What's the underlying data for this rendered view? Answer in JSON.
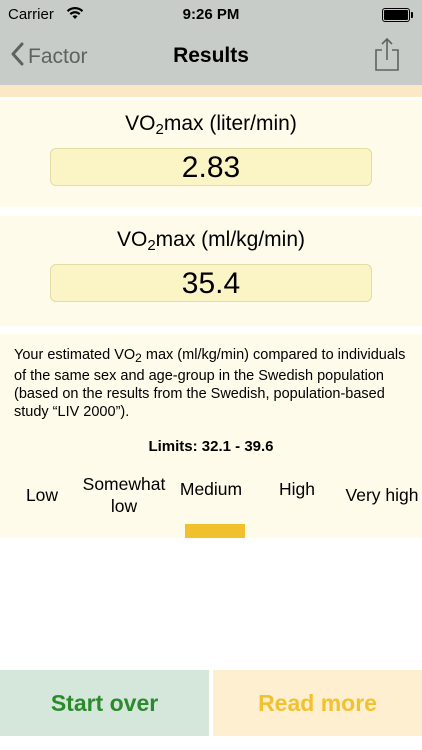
{
  "status_bar": {
    "carrier": "Carrier",
    "time": "9:26 PM",
    "battery_level": 1.0
  },
  "nav": {
    "back_label": "Factor",
    "title": "Results"
  },
  "vo2_absolute": {
    "label_prefix": "VO",
    "label_sub": "2",
    "label_suffix": "max (liter/min)",
    "value": "2.83"
  },
  "vo2_relative": {
    "label_prefix": "VO",
    "label_sub": "2",
    "label_suffix": "max (ml/kg/min)",
    "value": "35.4"
  },
  "info": {
    "desc_prefix": "Your estimated VO",
    "desc_sub": "2",
    "desc_suffix": " max (ml/kg/min) compared to individuals of the same sex and age-group in the Swedish population (based on the results from the Swedish, population-based study “LIV 2000”).",
    "limits": "Limits: 32.1 - 39.6"
  },
  "scale": {
    "categories": [
      "Low",
      "Somewhat low",
      "Medium",
      "High",
      "Very high"
    ],
    "selected_index": 2,
    "indicator_color": "#f1c02d"
  },
  "buttons": {
    "start_over": "Start over",
    "read_more": "Read more"
  },
  "colors": {
    "header_bg": "#c8ccc9",
    "card_bg": "#fefbea",
    "value_bg": "#fbf4c5",
    "start_over_text": "#2b8a2e",
    "read_more_text": "#f2c12e"
  }
}
